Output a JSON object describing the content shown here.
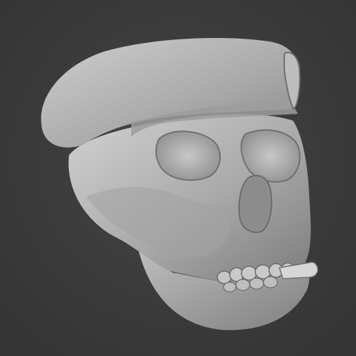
{
  "scene": {
    "subject_icon": "skull-with-beret-sculpt",
    "background_color": "#3a3a3a",
    "material_color": "#b9b9b9",
    "elements": [
      "beret",
      "beret-badge",
      "skull-cranium",
      "left-eye-socket",
      "right-eye-socket",
      "nasal-cavity",
      "cheekbone",
      "upper-teeth",
      "lower-jaw",
      "cigarette"
    ]
  }
}
